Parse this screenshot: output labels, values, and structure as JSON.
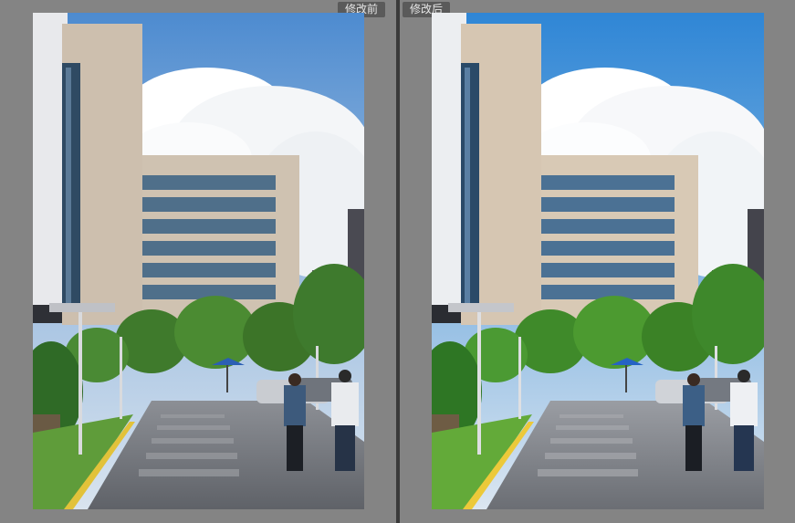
{
  "labels": {
    "before": "修改前",
    "after": "修改后"
  },
  "colors": {
    "panel_bg": "#848484",
    "divider": "#3a3a3a",
    "label_bg": "#5a5a5a",
    "label_text": "#e6e6e6"
  },
  "images": {
    "before": {
      "tone": "original"
    },
    "after": {
      "tone": "edited"
    }
  }
}
